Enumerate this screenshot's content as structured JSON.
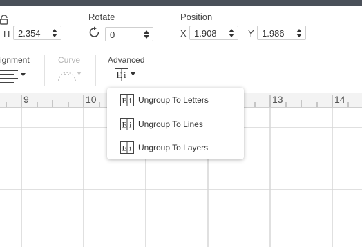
{
  "toolbar": {
    "size": {
      "h_label": "H",
      "h_value": "2.354"
    },
    "rotate": {
      "label": "Rotate",
      "value": "0"
    },
    "position": {
      "label": "Position",
      "x_label": "X",
      "x_value": "1.908",
      "y_label": "Y",
      "y_value": "1.986"
    },
    "alignment": {
      "label": "ignment"
    },
    "curve": {
      "label": "Curve"
    },
    "advanced": {
      "label": "Advanced"
    }
  },
  "ruler": {
    "numbers": [
      "9",
      "10",
      "13",
      "14"
    ]
  },
  "menu": {
    "items": [
      {
        "label": "Ungroup To Letters"
      },
      {
        "label": "Ungroup To Lines"
      },
      {
        "label": "Ungroup To Layers"
      }
    ]
  },
  "icons": {
    "lock": "lock-icon",
    "rotate": "rotate-icon",
    "align": "align-icon",
    "curve": "curve-icon",
    "advanced": "ungroup-text-icon"
  },
  "colors": {
    "topbar": "#4a5059",
    "grid": "#d6d6d6",
    "disabled": "#b5b5b5"
  }
}
